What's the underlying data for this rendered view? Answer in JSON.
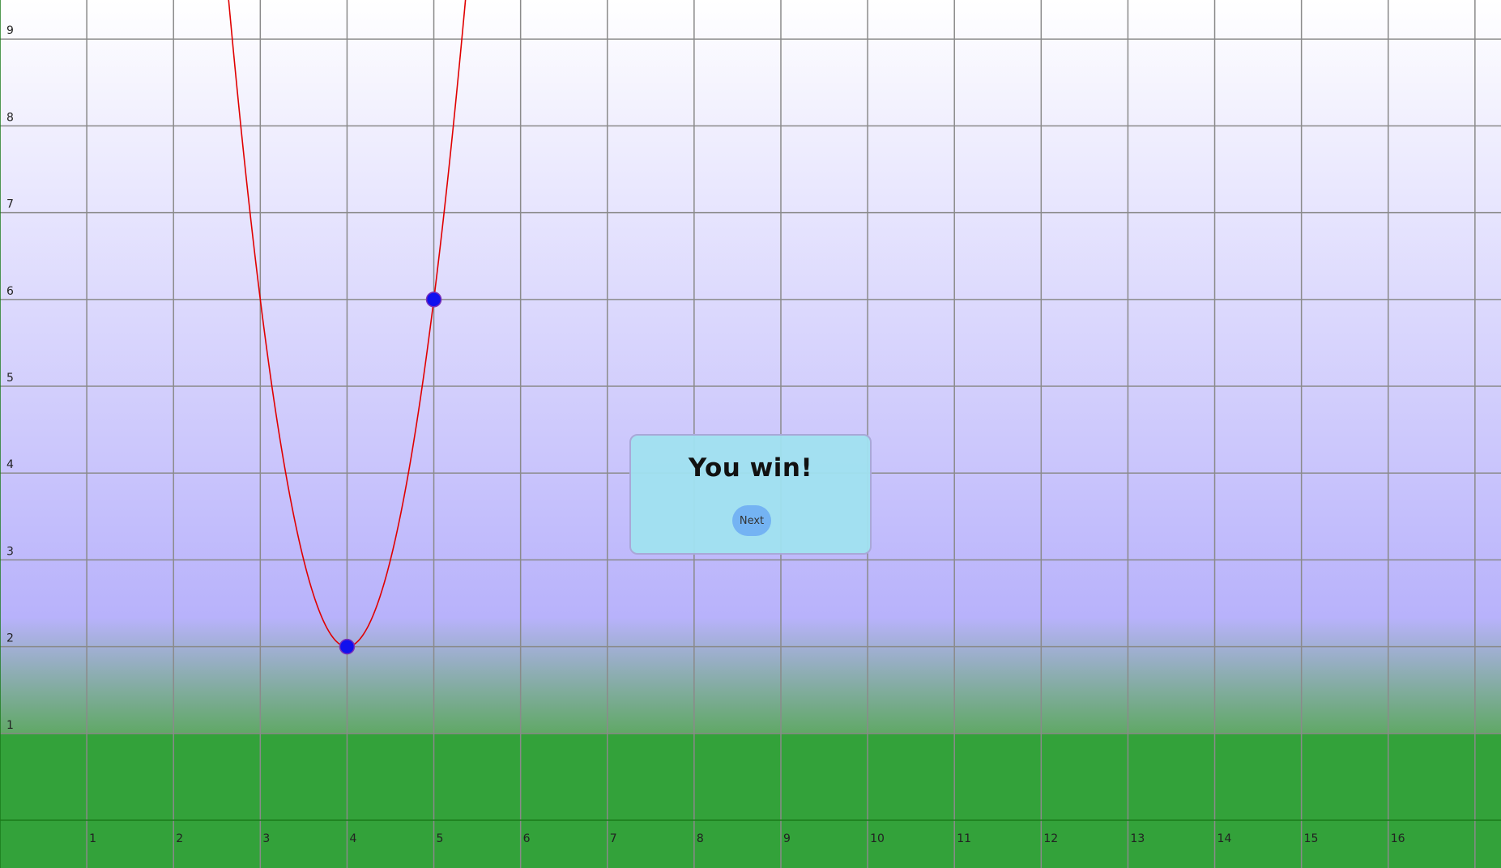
{
  "graph": {
    "x_ticks": [
      "1",
      "2",
      "3",
      "4",
      "5",
      "6",
      "7",
      "8",
      "9",
      "10",
      "11",
      "12",
      "13",
      "14",
      "15",
      "16"
    ],
    "y_ticks": [
      "1",
      "2",
      "3",
      "4",
      "5",
      "6",
      "7",
      "8",
      "9"
    ],
    "x_range": [
      0,
      17.3
    ],
    "y_range": [
      -0.55,
      9.45
    ],
    "ground_level": 1,
    "curve": {
      "type": "parabola",
      "vertex": [
        4,
        2
      ],
      "a": 4,
      "color": "#e00000"
    },
    "points": [
      {
        "x": 4,
        "y": 2
      },
      {
        "x": 5,
        "y": 6
      }
    ],
    "colors": {
      "sky_top": "#ffffff",
      "sky_bottom": "#b8b2fb",
      "ground": "#33a23a",
      "grid": "#8a8a8a",
      "axis": "#1a7a1a",
      "point": "#1010ee"
    }
  },
  "dialog": {
    "title": "You win!",
    "next_label": "Next"
  }
}
